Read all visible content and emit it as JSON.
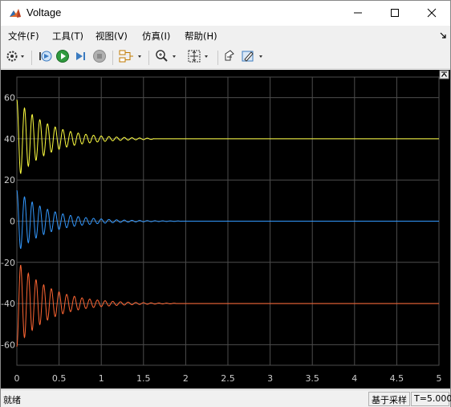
{
  "window": {
    "title": "Voltage",
    "minimize_icon": "minimize-icon",
    "maximize_icon": "maximize-icon",
    "close_icon": "close-icon"
  },
  "menubar": {
    "items": [
      {
        "label": "文件(F)"
      },
      {
        "label": "工具(T)"
      },
      {
        "label": "视图(V)"
      },
      {
        "label": "仿真(I)"
      },
      {
        "label": "帮助(H)"
      }
    ]
  },
  "toolbar": {
    "buttons": [
      "settings-icon",
      "step-back-icon",
      "run-icon",
      "step-forward-icon",
      "stop-icon",
      "signal-select-icon",
      "zoom-icon",
      "fit-to-view-icon",
      "highlight-block-icon",
      "style-edit-icon"
    ]
  },
  "colors": {
    "background": "#000000",
    "grid": "#4d4d4d",
    "series1": "#ffff40",
    "series2": "#3399ff",
    "series3": "#ff6633",
    "tick": "#cccccc"
  },
  "chart_data": {
    "type": "line",
    "xlim": [
      0,
      5
    ],
    "ylim": [
      -70,
      70
    ],
    "x_ticks": [
      "0",
      "0.5",
      "1",
      "1.5",
      "2",
      "2.5",
      "3",
      "3.5",
      "4",
      "4.5",
      "5"
    ],
    "y_ticks": [
      "60",
      "40",
      "20",
      "0",
      "-20",
      "-40",
      "-60"
    ],
    "grid": true,
    "series": [
      {
        "offset": 40,
        "amplitude": 19,
        "frequency_hz": 11,
        "decay_time": 0.38,
        "end_visible": 1.62,
        "color": "#ffff40"
      },
      {
        "offset": 0,
        "amplitude": 15,
        "frequency_hz": 11,
        "decay_time": 0.38,
        "end_visible": 1.95,
        "color": "#3399ff"
      },
      {
        "offset": -40,
        "amplitude": 21,
        "frequency_hz": 11,
        "decay_time": 0.38,
        "end_visible": 1.88,
        "color": "#ff6633"
      }
    ]
  },
  "statusbar": {
    "state": "就绪",
    "mode": "基于采样",
    "time": "T=5.000"
  }
}
